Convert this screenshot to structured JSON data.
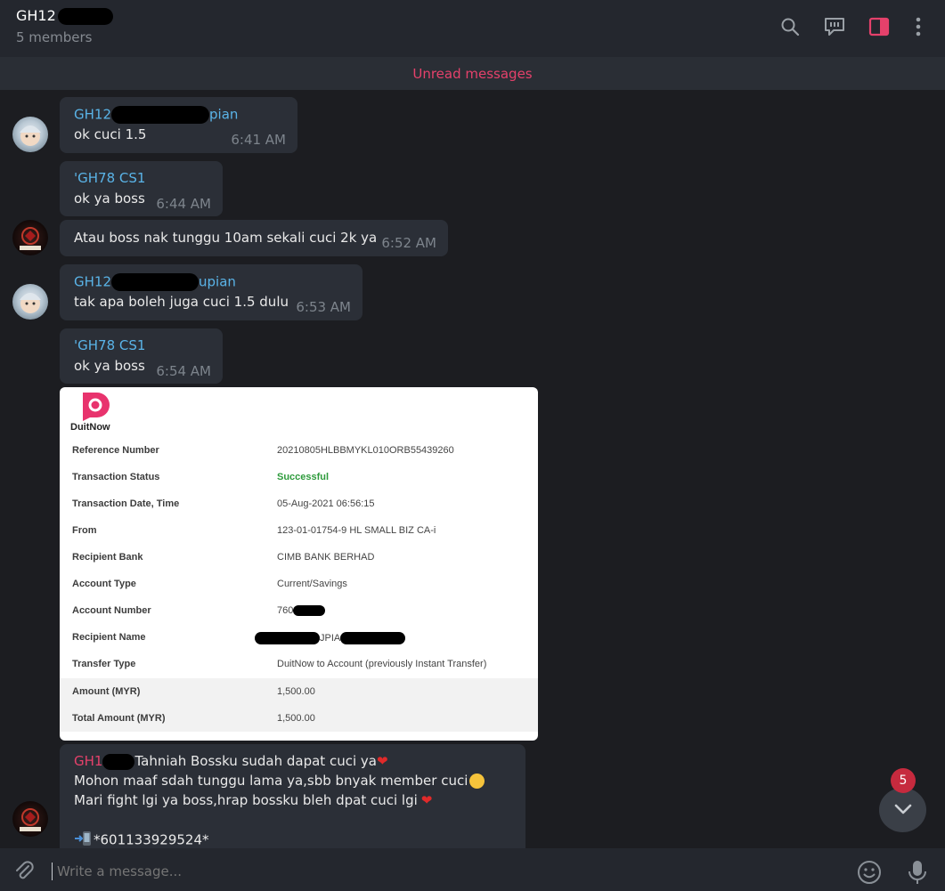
{
  "header": {
    "title": "GH12",
    "subtitle": "5 members"
  },
  "unread_label": "Unread messages",
  "messages": [
    {
      "sender": "GH12",
      "sender_suffix": "pian",
      "text": "ok cuci 1.5",
      "time": "6:41 AM"
    },
    {
      "sender": "'GH78 CS1",
      "text": "ok ya boss",
      "time": "6:44 AM"
    },
    {
      "text": "Atau boss nak tunggu 10am sekali cuci 2k ya",
      "time": "6:52 AM"
    },
    {
      "sender": "GH12",
      "sender_suffix": "upian",
      "text": "tak apa boleh juga cuci 1.5 dulu",
      "time": "6:53 AM"
    },
    {
      "sender": "'GH78 CS1",
      "text": "ok ya boss",
      "time": "6:54 AM"
    }
  ],
  "receipt": {
    "logo_text": "DuitNow",
    "rows": [
      {
        "label": "Reference Number",
        "value": "20210805HLBBMYKL010ORB55439260"
      },
      {
        "label": "Transaction Status",
        "value": "Successful"
      },
      {
        "label": "Transaction Date, Time",
        "value": "05-Aug-2021 06:56:15"
      },
      {
        "label": "From",
        "value": "123-01-01754-9 HL SMALL BIZ CA-i"
      },
      {
        "label": "Recipient Bank",
        "value": "CIMB BANK BERHAD"
      },
      {
        "label": "Account Type",
        "value": "Current/Savings"
      },
      {
        "label": "Account Number",
        "value": "760"
      },
      {
        "label": "Recipient Name",
        "value": "JPIA"
      },
      {
        "label": "Transfer Type",
        "value": "DuitNow to Account (previously Instant Transfer)"
      },
      {
        "label": "Amount (MYR)",
        "value": "1,500.00"
      },
      {
        "label": "Total Amount (MYR)",
        "value": "1,500.00"
      }
    ],
    "status_color": "#2e9b3c"
  },
  "last_message": {
    "sender": "GH1",
    "line1": "Tahniah Bossku sudah dapat cuci ya",
    "line2": "Mohon maaf sdah tunggu lama ya,sbb bnyak member cuci",
    "line3": "Mari fight lgi ya boss,hrap bossku bleh dpat cuci lgi",
    "line4": "*601133929524*"
  },
  "scroll_badge": "5",
  "composer": {
    "placeholder": "Write a message..."
  },
  "colors": {
    "accent": "#e5416b",
    "link": "#5ab4e8",
    "bubble": "#2b2f37",
    "background": "#1c1d21"
  },
  "icons": [
    "search-icon",
    "poll-icon",
    "sidebar-toggle-icon",
    "more-vertical-icon",
    "attach-icon",
    "emoji-icon",
    "microphone-icon",
    "chevron-down-icon"
  ]
}
